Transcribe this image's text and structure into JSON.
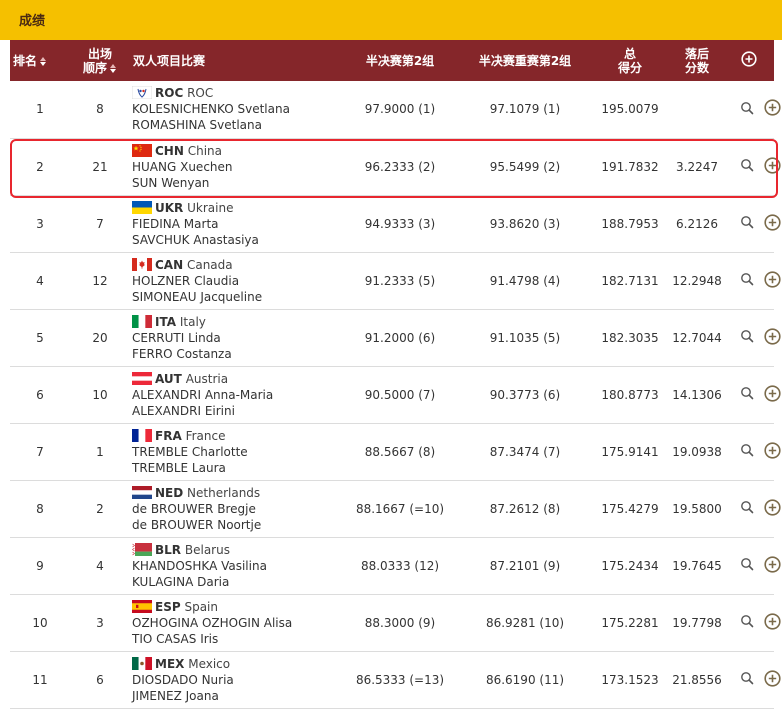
{
  "page": {
    "title": "成绩"
  },
  "table": {
    "headers": {
      "rank": "排名",
      "order_line1": "出场",
      "order_line2": "顺序",
      "event": "双人项目比赛",
      "semi": "半决赛第2组",
      "semi_rep": "半决赛重赛第2组",
      "total_line1": "总",
      "total_line2": "得分",
      "behind_line1": "落后",
      "behind_line2": "分数"
    },
    "rows": [
      {
        "rank": "1",
        "order": "8",
        "noc": "ROC",
        "country": "ROC",
        "athlete1": "KOLESNICHENKO Svetlana",
        "athlete2": "ROMASHINA Svetlana",
        "semi": "97.9000 (1)",
        "semi_rep": "97.1079 (1)",
        "total": "195.0079",
        "behind": ""
      },
      {
        "rank": "2",
        "order": "21",
        "noc": "CHN",
        "country": "China",
        "athlete1": "HUANG Xuechen",
        "athlete2": "SUN Wenyan",
        "semi": "96.2333 (2)",
        "semi_rep": "95.5499 (2)",
        "total": "191.7832",
        "behind": "3.2247"
      },
      {
        "rank": "3",
        "order": "7",
        "noc": "UKR",
        "country": "Ukraine",
        "athlete1": "FIEDINA Marta",
        "athlete2": "SAVCHUK Anastasiya",
        "semi": "94.9333 (3)",
        "semi_rep": "93.8620 (3)",
        "total": "188.7953",
        "behind": "6.2126"
      },
      {
        "rank": "4",
        "order": "12",
        "noc": "CAN",
        "country": "Canada",
        "athlete1": "HOLZNER Claudia",
        "athlete2": "SIMONEAU Jacqueline",
        "semi": "91.2333 (5)",
        "semi_rep": "91.4798 (4)",
        "total": "182.7131",
        "behind": "12.2948"
      },
      {
        "rank": "5",
        "order": "20",
        "noc": "ITA",
        "country": "Italy",
        "athlete1": "CERRUTI Linda",
        "athlete2": "FERRO Costanza",
        "semi": "91.2000 (6)",
        "semi_rep": "91.1035 (5)",
        "total": "182.3035",
        "behind": "12.7044"
      },
      {
        "rank": "6",
        "order": "10",
        "noc": "AUT",
        "country": "Austria",
        "athlete1": "ALEXANDRI Anna-Maria",
        "athlete2": "ALEXANDRI Eirini",
        "semi": "90.5000 (7)",
        "semi_rep": "90.3773 (6)",
        "total": "180.8773",
        "behind": "14.1306"
      },
      {
        "rank": "7",
        "order": "1",
        "noc": "FRA",
        "country": "France",
        "athlete1": "TREMBLE Charlotte",
        "athlete2": "TREMBLE Laura",
        "semi": "88.5667 (8)",
        "semi_rep": "87.3474 (7)",
        "total": "175.9141",
        "behind": "19.0938"
      },
      {
        "rank": "8",
        "order": "2",
        "noc": "NED",
        "country": "Netherlands",
        "athlete1": "de BROUWER Bregje",
        "athlete2": "de BROUWER Noortje",
        "semi": "88.1667 (=10)",
        "semi_rep": "87.2612 (8)",
        "total": "175.4279",
        "behind": "19.5800"
      },
      {
        "rank": "9",
        "order": "4",
        "noc": "BLR",
        "country": "Belarus",
        "athlete1": "KHANDOSHKA Vasilina",
        "athlete2": "KULAGINA Daria",
        "semi": "88.0333 (12)",
        "semi_rep": "87.2101 (9)",
        "total": "175.2434",
        "behind": "19.7645"
      },
      {
        "rank": "10",
        "order": "3",
        "noc": "ESP",
        "country": "Spain",
        "athlete1": "OZHOGINA OZHOGIN Alisa",
        "athlete2": "TIO CASAS Iris",
        "semi": "88.3000 (9)",
        "semi_rep": "86.9281 (10)",
        "total": "175.2281",
        "behind": "19.7798"
      },
      {
        "rank": "11",
        "order": "6",
        "noc": "MEX",
        "country": "Mexico",
        "athlete1": "DIOSDADO Nuria",
        "athlete2": "JIMENEZ Joana",
        "semi": "86.5333 (=13)",
        "semi_rep": "86.6190 (11)",
        "total": "173.1523",
        "behind": "21.8556"
      }
    ]
  },
  "icons": {
    "expand": "plus-circle-icon",
    "details": "magnifier-icon",
    "sort": "sort-arrows-icon"
  },
  "colors": {
    "title_bar": "#f5c000",
    "header_bg": "#85262a",
    "highlight": "#e8262e"
  }
}
